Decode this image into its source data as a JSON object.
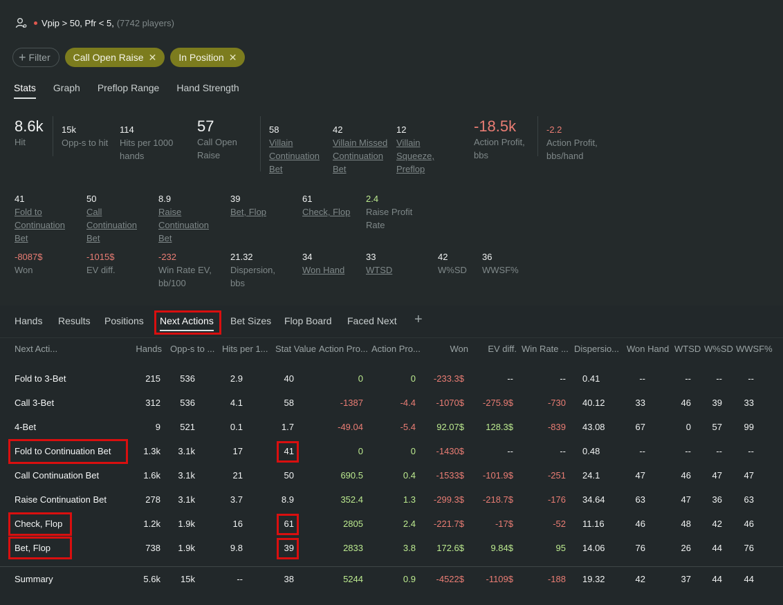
{
  "header": {
    "segment_title": "Vpip > 50, Pfr < 5",
    "players": "(7742 players)"
  },
  "filters": {
    "add_label": "Filter",
    "chips": [
      "Call Open Raise",
      "In Position"
    ]
  },
  "top_tabs": [
    "Stats",
    "Graph",
    "Preflop Range",
    "Hand Strength"
  ],
  "stats_row1": {
    "hit": {
      "value": "8.6k",
      "label": "Hit"
    },
    "opps": {
      "value": "15k",
      "label": "Opp-s to hit"
    },
    "hits1000": {
      "value": "114",
      "label1": "Hits per 1000",
      "label2": "hands"
    },
    "call_open": {
      "value": "57",
      "label1": "Call Open",
      "label2": "Raise"
    },
    "villain_cbet": {
      "value": "58",
      "label1": "Villain",
      "label2": "Continuation",
      "label3": "Bet"
    },
    "villain_missed": {
      "value": "42",
      "label1": "Villain Missed",
      "label2": "Continuation",
      "label3": "Bet"
    },
    "villain_squeeze": {
      "value": "12",
      "label1": "Villain",
      "label2": "Squeeze,",
      "label3": "Preflop"
    },
    "action_profit": {
      "value": "-18.5k",
      "label1": "Action Profit,",
      "label2": "bbs"
    },
    "action_profit_hand": {
      "value": "-2.2",
      "label1": "Action Profit,",
      "label2": "bbs/hand"
    }
  },
  "stats_row2": {
    "fold_cbet": {
      "value": "41",
      "label1": "Fold to",
      "label2": "Continuation",
      "label3": "Bet"
    },
    "call_cbet": {
      "value": "50",
      "label1": "Call",
      "label2": "Continuation",
      "label3": "Bet"
    },
    "raise_cbet": {
      "value": "8.9",
      "label1": "Raise",
      "label2": "Continuation",
      "label3": "Bet"
    },
    "bet_flop": {
      "value": "39",
      "label1": "Bet, Flop"
    },
    "check_flop": {
      "value": "61",
      "label1": "Check, Flop"
    },
    "raise_profit": {
      "value": "2.4",
      "label1": "Raise Profit",
      "label2": "Rate"
    }
  },
  "stats_row3": {
    "won": {
      "value": "-8087$",
      "label1": "Won"
    },
    "ev_diff": {
      "value": "-1015$",
      "label1": "EV diff."
    },
    "win_rate": {
      "value": "-232",
      "label1": "Win Rate EV,",
      "label2": "bb/100"
    },
    "dispersion": {
      "value": "21.32",
      "label1": "Dispersion,",
      "label2": "bbs"
    },
    "won_hand": {
      "value": "34",
      "label1": "Won Hand"
    },
    "wtsd": {
      "value": "33",
      "label1": "WTSD"
    },
    "wsd": {
      "value": "42",
      "label1": "W%SD"
    },
    "wwsf": {
      "value": "36",
      "label1": "WWSF%"
    }
  },
  "bottom_tabs": [
    "Hands",
    "Results",
    "Positions",
    "Next Actions",
    "Bet Sizes",
    "Flop Board",
    "Faced Next",
    "+"
  ],
  "table": {
    "columns": [
      "Next Acti...",
      "Hands",
      "Opp-s to ...",
      "Hits per 1...",
      "Stat Value",
      "Action Pro...",
      "Action Pro...",
      "Won",
      "EV diff.",
      "Win Rate ...",
      "Dispersio...",
      "Won Hand",
      "WTSD",
      "W%SD",
      "WWSF%"
    ],
    "rows": [
      [
        "Fold to 3-Bet",
        "215",
        "536",
        "2.9",
        "40",
        "0",
        "0",
        "-233.3$",
        "--",
        "--",
        "0.41",
        "--",
        "--",
        "--",
        "--"
      ],
      [
        "Call 3-Bet",
        "312",
        "536",
        "4.1",
        "58",
        "-1387",
        "-4.4",
        "-1070$",
        "-275.9$",
        "-730",
        "40.12",
        "33",
        "46",
        "39",
        "33"
      ],
      [
        "4-Bet",
        "9",
        "521",
        "0.1",
        "1.7",
        "-49.04",
        "-5.4",
        "92.07$",
        "128.3$",
        "-839",
        "43.08",
        "67",
        "0",
        "57",
        "99"
      ],
      [
        "Fold to Continuation Bet",
        "1.3k",
        "3.1k",
        "17",
        "41",
        "0",
        "0",
        "-1430$",
        "--",
        "--",
        "0.48",
        "--",
        "--",
        "--",
        "--"
      ],
      [
        "Call Continuation Bet",
        "1.6k",
        "3.1k",
        "21",
        "50",
        "690.5",
        "0.4",
        "-1533$",
        "-101.9$",
        "-251",
        "24.1",
        "47",
        "46",
        "47",
        "47"
      ],
      [
        "Raise Continuation Bet",
        "278",
        "3.1k",
        "3.7",
        "8.9",
        "352.4",
        "1.3",
        "-299.3$",
        "-218.7$",
        "-176",
        "34.64",
        "63",
        "47",
        "36",
        "63"
      ],
      [
        "Check, Flop",
        "1.2k",
        "1.9k",
        "16",
        "61",
        "2805",
        "2.4",
        "-221.7$",
        "-17$",
        "-52",
        "11.16",
        "46",
        "48",
        "42",
        "46"
      ],
      [
        "Bet, Flop",
        "738",
        "1.9k",
        "9.8",
        "39",
        "2833",
        "3.8",
        "172.6$",
        "9.84$",
        "95",
        "14.06",
        "76",
        "26",
        "44",
        "76"
      ]
    ],
    "summary": [
      "Summary",
      "5.6k",
      "15k",
      "--",
      "38",
      "5244",
      "0.9",
      "-4522$",
      "-1109$",
      "-188",
      "19.32",
      "42",
      "37",
      "44",
      "44"
    ]
  },
  "colors": {
    "positive": "#bcea8f",
    "negative": "#ea7d74",
    "chip": "#7c7c1e",
    "highlight": "#d90f0f"
  },
  "icons": {
    "segment": "users-settings-icon",
    "add_filter": "plus-icon",
    "remove_chip": "close-icon"
  }
}
